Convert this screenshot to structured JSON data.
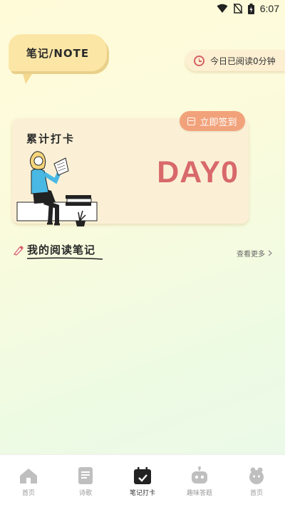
{
  "status_bar": {
    "time": "6:07",
    "icons": [
      "wifi-icon",
      "no-sim-icon",
      "battery-charging-icon"
    ]
  },
  "note_bubble": {
    "title": "笔记/NOTE"
  },
  "reading_time": {
    "label": "今日已阅读0分钟",
    "icon": "clock-icon"
  },
  "checkin": {
    "title": "累计打卡",
    "day_count": "DAY0",
    "signin_label": "立即签到",
    "signin_icon": "calendar-icon"
  },
  "notes_section": {
    "heading": "我的阅读笔记",
    "more_label": "查看更多"
  },
  "bottom_nav": {
    "items": [
      {
        "label": "首页",
        "icon": "home-icon",
        "active": false
      },
      {
        "label": "诗歌",
        "icon": "document-icon",
        "active": false
      },
      {
        "label": "笔记打卡",
        "icon": "calendar-check-icon",
        "active": true
      },
      {
        "label": "趣味答题",
        "icon": "robot-icon",
        "active": false
      },
      {
        "label": "首页",
        "icon": "avatar-icon",
        "active": false
      }
    ]
  },
  "colors": {
    "accent": "#d8696b",
    "signin_button": "#f2a27a",
    "card_bg": "#fbf0d6",
    "bubble_bg": "#fbe6a6"
  }
}
